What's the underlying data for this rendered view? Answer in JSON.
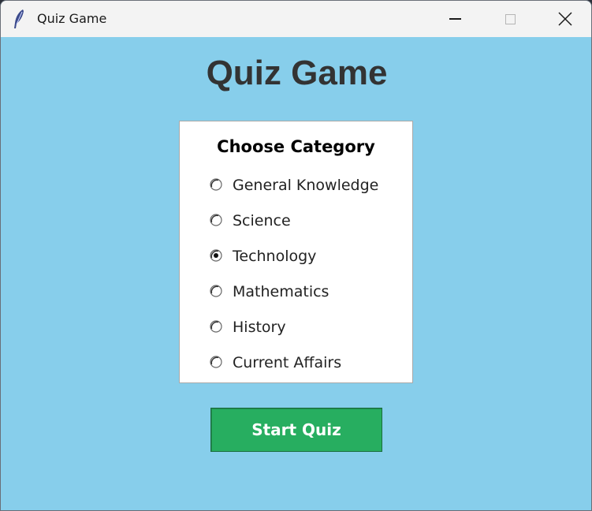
{
  "window": {
    "title": "Quiz Game",
    "app_icon": "feather-icon",
    "controls": {
      "minimize_icon": "minimize-icon",
      "maximize_icon": "maximize-icon",
      "close_icon": "close-icon"
    }
  },
  "main": {
    "heading": "Quiz Game",
    "category_panel": {
      "title": "Choose Category",
      "options": [
        {
          "label": "General Knowledge",
          "selected": false
        },
        {
          "label": "Science",
          "selected": false
        },
        {
          "label": "Technology",
          "selected": true
        },
        {
          "label": "Mathematics",
          "selected": false
        },
        {
          "label": "History",
          "selected": false
        },
        {
          "label": "Current Affairs",
          "selected": false
        }
      ]
    },
    "start_button_label": "Start Quiz"
  },
  "colors": {
    "background": "#87ceeb",
    "heading_text": "#333333",
    "start_button": "#27ae60",
    "panel_background": "#ffffff"
  }
}
